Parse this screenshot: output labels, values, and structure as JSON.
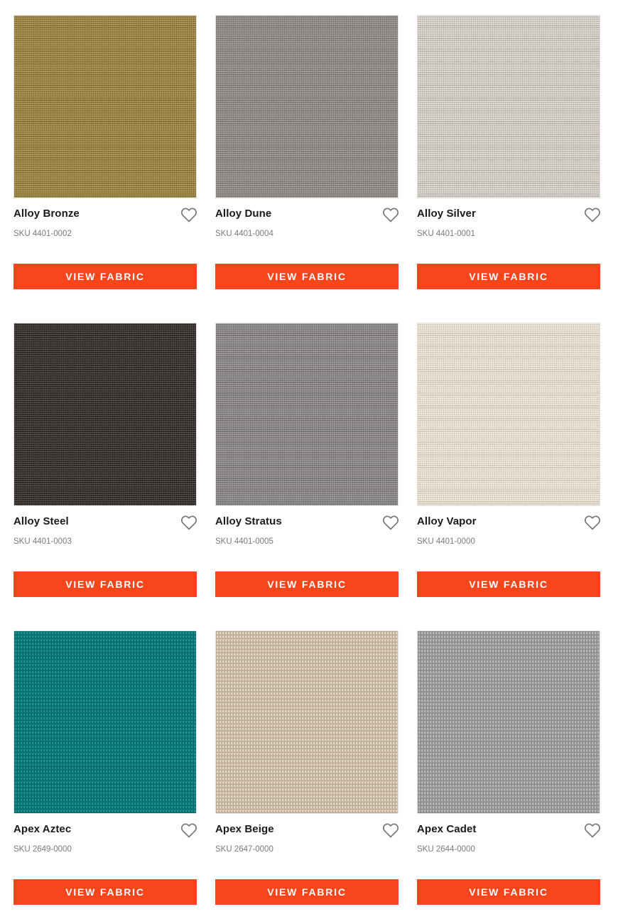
{
  "products": [
    {
      "name": "Alloy Bronze",
      "sku": "SKU 4401-0002",
      "button_label": "VIEW FABRIC",
      "swatch_color": "#9d8545",
      "swatch_hi": "#b09a5a",
      "swatch_lo": "#7c6834",
      "pattern": "linen",
      "favorite_icon": "heart-outline-icon"
    },
    {
      "name": "Alloy Dune",
      "sku": "SKU 4401-0004",
      "button_label": "VIEW FABRIC",
      "swatch_color": "#8e8a87",
      "swatch_hi": "#a29e9b",
      "swatch_lo": "#76726f",
      "pattern": "linen",
      "favorite_icon": "heart-outline-icon"
    },
    {
      "name": "Alloy Silver",
      "sku": "SKU 4401-0001",
      "button_label": "VIEW FABRIC",
      "swatch_color": "#cfcac3",
      "swatch_hi": "#e0dcd6",
      "swatch_lo": "#b4afa8",
      "pattern": "linen",
      "favorite_icon": "heart-outline-icon"
    },
    {
      "name": "Alloy Steel",
      "sku": "SKU 4401-0003",
      "button_label": "VIEW FABRIC",
      "swatch_color": "#3a3532",
      "swatch_hi": "#56504c",
      "swatch_lo": "#221f1d",
      "pattern": "linen",
      "favorite_icon": "heart-outline-icon"
    },
    {
      "name": "Alloy Stratus",
      "sku": "SKU 4401-0005",
      "button_label": "VIEW FABRIC",
      "swatch_color": "#8a8787",
      "swatch_hi": "#a09d9c",
      "swatch_lo": "#6f6c6c",
      "pattern": "linen",
      "favorite_icon": "heart-outline-icon"
    },
    {
      "name": "Alloy Vapor",
      "sku": "SKU 4401-0000",
      "button_label": "VIEW FABRIC",
      "swatch_color": "#e4ddcd",
      "swatch_hi": "#efe9dc",
      "swatch_lo": "#cdc5b4",
      "pattern": "linen",
      "favorite_icon": "heart-outline-icon"
    },
    {
      "name": "Apex Aztec",
      "sku": "SKU 2649-0000",
      "button_label": "VIEW FABRIC",
      "swatch_color": "#0c7f80",
      "swatch_hi": "#1d9394",
      "swatch_lo": "#066566",
      "pattern": "knit",
      "favorite_icon": "heart-outline-icon"
    },
    {
      "name": "Apex Beige",
      "sku": "SKU 2647-0000",
      "button_label": "VIEW FABRIC",
      "swatch_color": "#d3c4ad",
      "swatch_hi": "#e2d6c3",
      "swatch_lo": "#b9a991",
      "pattern": "knit",
      "favorite_icon": "heart-outline-icon"
    },
    {
      "name": "Apex Cadet",
      "sku": "SKU 2644-0000",
      "button_label": "VIEW FABRIC",
      "swatch_color": "#a3a2a5",
      "swatch_hi": "#b8b7ba",
      "swatch_lo": "#89888b",
      "pattern": "knit",
      "favorite_icon": "heart-outline-icon"
    }
  ],
  "accent_color": "#f9451b"
}
